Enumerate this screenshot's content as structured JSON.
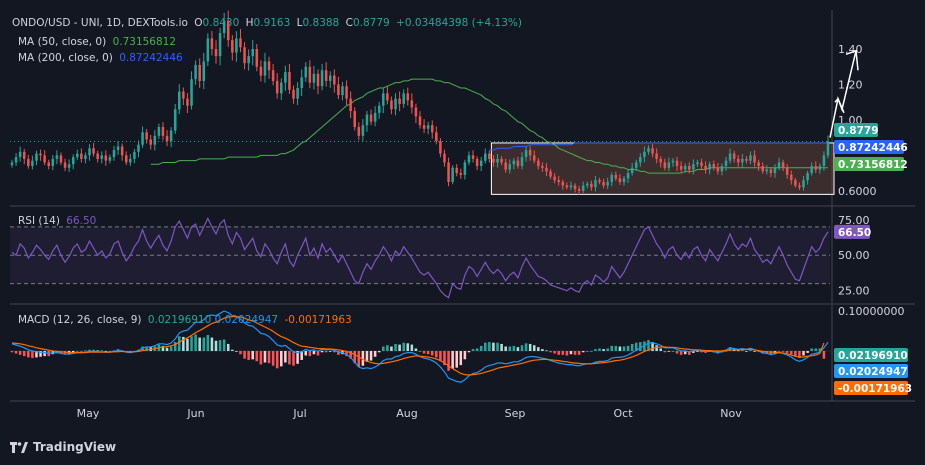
{
  "header": {
    "symbol": "ONDO/USD - UNI, 1D, DEXTools.io",
    "o_label": "O",
    "o": "0.8430",
    "h_label": "H",
    "h": "0.9163",
    "l_label": "L",
    "l": "0.8388",
    "c_label": "C",
    "c": "0.8779",
    "change": "+0.03484398 (+4.13%)",
    "ma50_label": "MA (50, close, 0)",
    "ma50": "0.73156812",
    "ma200_label": "MA (200, close, 0)",
    "ma200": "0.87242446"
  },
  "rsi_legend": {
    "label": "RSI (14)",
    "value": "66.50"
  },
  "macd_legend": {
    "label": "MACD (12, 26, close, 9)",
    "macd": "0.02196910",
    "signal": "0.02024947",
    "hist": "-0.00171963"
  },
  "brand": {
    "name": "TradingView"
  },
  "colors": {
    "background": "#131722",
    "up": "#26a69a",
    "down": "#ef5350",
    "ma50": "#4caf50",
    "ma200": "#2962ff",
    "rsi": "#7e57c2",
    "macd": "#2196f3",
    "signal": "#ff6d00",
    "box_border": "#ffffff",
    "box_fill": "#5d4037"
  },
  "chart_data": [
    {
      "type": "candlestick",
      "title": "ONDO/USD - UNI, 1D, DEXTools.io",
      "x_ticks": [
        "May",
        "Jun",
        "Jul",
        "Aug",
        "Sep",
        "Oct",
        "Nov"
      ],
      "y_ticks": [
        "1.40",
        "1.20",
        "1.00",
        "0.6000"
      ],
      "ylim": [
        0.52,
        1.62
      ],
      "price_labels": [
        {
          "text": "0.8779",
          "value": 0.8779,
          "color": "#26a69a"
        },
        {
          "text": "0.87242446",
          "value": 0.8724,
          "color": "#2962ff"
        },
        {
          "text": "0.73156812",
          "value": 0.7316,
          "color": "#4caf50"
        }
      ],
      "close_series": [
        0.76,
        0.79,
        0.82,
        0.78,
        0.74,
        0.77,
        0.81,
        0.8,
        0.76,
        0.74,
        0.78,
        0.8,
        0.76,
        0.73,
        0.75,
        0.79,
        0.81,
        0.78,
        0.8,
        0.84,
        0.81,
        0.78,
        0.8,
        0.77,
        0.79,
        0.83,
        0.85,
        0.8,
        0.76,
        0.78,
        0.82,
        0.86,
        0.93,
        0.89,
        0.86,
        0.91,
        0.96,
        0.91,
        0.88,
        0.94,
        1.06,
        1.16,
        1.12,
        1.08,
        1.23,
        1.31,
        1.22,
        1.33,
        1.46,
        1.4,
        1.36,
        1.49,
        1.56,
        1.45,
        1.38,
        1.46,
        1.41,
        1.32,
        1.36,
        1.4,
        1.3,
        1.25,
        1.33,
        1.28,
        1.22,
        1.15,
        1.21,
        1.27,
        1.17,
        1.12,
        1.18,
        1.24,
        1.3,
        1.21,
        1.26,
        1.19,
        1.28,
        1.22,
        1.25,
        1.2,
        1.14,
        1.19,
        1.12,
        1.05,
        0.96,
        0.91,
        0.97,
        1.03,
        0.99,
        1.04,
        1.08,
        1.15,
        1.11,
        1.06,
        1.12,
        1.09,
        1.15,
        1.11,
        1.07,
        1.02,
        0.97,
        0.95,
        0.97,
        0.93,
        0.88,
        0.81,
        0.76,
        0.65,
        0.73,
        0.7,
        0.69,
        0.76,
        0.8,
        0.78,
        0.74,
        0.77,
        0.81,
        0.78,
        0.76,
        0.78,
        0.76,
        0.72,
        0.75,
        0.77,
        0.74,
        0.79,
        0.83,
        0.8,
        0.77,
        0.74,
        0.73,
        0.71,
        0.68,
        0.66,
        0.65,
        0.63,
        0.62,
        0.63,
        0.61,
        0.6,
        0.63,
        0.64,
        0.62,
        0.66,
        0.65,
        0.63,
        0.65,
        0.69,
        0.67,
        0.65,
        0.67,
        0.7,
        0.73,
        0.76,
        0.79,
        0.82,
        0.84,
        0.81,
        0.78,
        0.76,
        0.73,
        0.76,
        0.77,
        0.74,
        0.72,
        0.74,
        0.72,
        0.75,
        0.76,
        0.74,
        0.72,
        0.75,
        0.73,
        0.71,
        0.74,
        0.77,
        0.81,
        0.78,
        0.76,
        0.78,
        0.77,
        0.8,
        0.76,
        0.74,
        0.71,
        0.72,
        0.7,
        0.73,
        0.76,
        0.73,
        0.69,
        0.66,
        0.63,
        0.62,
        0.66,
        0.7,
        0.74,
        0.72,
        0.74,
        0.8,
        0.88
      ],
      "ma50": [
        0.75,
        0.75,
        0.75,
        0.76,
        0.76,
        0.76,
        0.76,
        0.77,
        0.77,
        0.77,
        0.77,
        0.77,
        0.78,
        0.78,
        0.78,
        0.78,
        0.78,
        0.78,
        0.78,
        0.79,
        0.79,
        0.79,
        0.79,
        0.79,
        0.79,
        0.79,
        0.79,
        0.8,
        0.8,
        0.8,
        0.8,
        0.8,
        0.81,
        0.81,
        0.82,
        0.83,
        0.85,
        0.87,
        0.88,
        0.9,
        0.92,
        0.94,
        0.96,
        0.98,
        1.0,
        1.02,
        1.04,
        1.06,
        1.08,
        1.09,
        1.11,
        1.12,
        1.13,
        1.15,
        1.16,
        1.17,
        1.18,
        1.18,
        1.19,
        1.2,
        1.21,
        1.21,
        1.22,
        1.22,
        1.23,
        1.23,
        1.23,
        1.23,
        1.23,
        1.23,
        1.22,
        1.22,
        1.21,
        1.21,
        1.2,
        1.19,
        1.18,
        1.18,
        1.17,
        1.16,
        1.15,
        1.14,
        1.12,
        1.11,
        1.09,
        1.08,
        1.06,
        1.05,
        1.03,
        1.01,
        0.99,
        0.98,
        0.96,
        0.94,
        0.93,
        0.91,
        0.9,
        0.88,
        0.87,
        0.86,
        0.84,
        0.83,
        0.82,
        0.81,
        0.8,
        0.79,
        0.78,
        0.77,
        0.77,
        0.76,
        0.76,
        0.75,
        0.75,
        0.74,
        0.74,
        0.73,
        0.73,
        0.72,
        0.72,
        0.72,
        0.71,
        0.71,
        0.7,
        0.7,
        0.7,
        0.7,
        0.7,
        0.7,
        0.7,
        0.7,
        0.7,
        0.71,
        0.71,
        0.71,
        0.72,
        0.72,
        0.72,
        0.73,
        0.73,
        0.73,
        0.73,
        0.73,
        0.73,
        0.73,
        0.73,
        0.73,
        0.73,
        0.73,
        0.73,
        0.73,
        0.73,
        0.73,
        0.73,
        0.73,
        0.73,
        0.73,
        0.73,
        0.73,
        0.73,
        0.73,
        0.73,
        0.73,
        0.73,
        0.73,
        0.73,
        0.73,
        0.73
      ],
      "ma200": [
        0.83,
        0.83,
        0.84,
        0.84,
        0.84,
        0.84,
        0.85,
        0.85,
        0.85,
        0.85,
        0.86,
        0.86,
        0.86,
        0.86,
        0.86,
        0.86,
        0.86,
        0.86,
        0.86,
        0.86,
        0.86,
        0.87,
        0.87,
        0.87,
        0.87,
        0.87,
        0.87,
        0.87,
        0.87,
        0.87,
        0.87,
        0.87,
        0.87,
        0.87,
        0.87,
        0.87,
        0.87,
        0.87,
        0.87,
        0.87,
        0.87,
        0.87,
        0.87,
        0.87,
        0.87,
        0.87,
        0.87,
        0.87,
        0.87,
        0.87,
        0.87,
        0.87,
        0.87,
        0.87,
        0.87,
        0.87,
        0.87,
        0.87,
        0.87,
        0.87,
        0.87,
        0.87,
        0.87,
        0.87,
        0.87,
        0.87,
        0.87,
        0.87,
        0.87,
        0.87,
        0.87,
        0.87,
        0.87,
        0.87,
        0.87,
        0.87,
        0.87,
        0.87,
        0.87,
        0.87,
        0.87,
        0.87,
        0.87,
        0.87
      ],
      "annotations": [
        "consolidation box",
        "arrows up"
      ]
    },
    {
      "type": "line",
      "title": "RSI (14)",
      "y_ticks": [
        "75.00",
        "50.00",
        "25.00"
      ],
      "ylim": [
        17,
        84
      ],
      "levels": [
        70,
        50,
        30
      ],
      "last_value": 66.5,
      "values": [
        52,
        50,
        58,
        55,
        48,
        52,
        57,
        54,
        50,
        47,
        53,
        57,
        50,
        45,
        49,
        55,
        58,
        52,
        54,
        60,
        55,
        50,
        53,
        48,
        51,
        58,
        60,
        52,
        46,
        50,
        56,
        60,
        68,
        60,
        55,
        60,
        64,
        57,
        53,
        60,
        70,
        74,
        68,
        62,
        70,
        72,
        64,
        70,
        76,
        70,
        65,
        72,
        75,
        64,
        58,
        66,
        62,
        54,
        58,
        62,
        53,
        49,
        58,
        54,
        48,
        44,
        52,
        58,
        46,
        42,
        50,
        56,
        62,
        50,
        55,
        48,
        58,
        52,
        55,
        50,
        45,
        50,
        44,
        38,
        32,
        30,
        38,
        44,
        40,
        46,
        50,
        56,
        52,
        46,
        53,
        50,
        56,
        52,
        48,
        43,
        38,
        36,
        38,
        34,
        30,
        25,
        22,
        20,
        30,
        27,
        26,
        36,
        42,
        40,
        35,
        40,
        45,
        40,
        37,
        40,
        37,
        32,
        36,
        38,
        34,
        42,
        48,
        43,
        39,
        35,
        34,
        32,
        29,
        28,
        27,
        26,
        25,
        27,
        25,
        24,
        30,
        32,
        29,
        36,
        34,
        31,
        34,
        42,
        38,
        34,
        38,
        44,
        50,
        56,
        62,
        68,
        70,
        64,
        58,
        54,
        48,
        54,
        56,
        50,
        47,
        52,
        48,
        54,
        56,
        50,
        46,
        54,
        50,
        46,
        52,
        58,
        65,
        58,
        54,
        58,
        56,
        62,
        54,
        50,
        45,
        47,
        44,
        50,
        56,
        50,
        43,
        38,
        33,
        32,
        40,
        48,
        56,
        52,
        55,
        62,
        66.5
      ]
    },
    {
      "type": "bar",
      "title": "MACD (12, 26, close, 9)",
      "y_ticks": [
        "0.10000000"
      ],
      "ylim": [
        -0.125,
        0.115
      ],
      "labels": [
        {
          "text": "0.02196910",
          "value": 0.022,
          "color": "#26a69a"
        },
        {
          "text": "0.02024947",
          "value": 0.0202,
          "color": "#2196f3"
        },
        {
          "text": "-0.00171963",
          "value": -0.0017,
          "color": "#ff6d00"
        }
      ],
      "macd": [
        0.018,
        0.015,
        0.012,
        0.008,
        0.003,
        0.0,
        -0.002,
        -0.003,
        -0.004,
        -0.006,
        -0.005,
        -0.004,
        -0.006,
        -0.008,
        -0.008,
        -0.006,
        -0.004,
        -0.004,
        -0.003,
        -0.001,
        -0.001,
        -0.002,
        -0.002,
        -0.003,
        -0.003,
        -0.001,
        0.001,
        0.0,
        -0.003,
        -0.004,
        -0.002,
        0.001,
        0.008,
        0.01,
        0.01,
        0.013,
        0.018,
        0.018,
        0.016,
        0.02,
        0.03,
        0.045,
        0.05,
        0.052,
        0.062,
        0.072,
        0.072,
        0.078,
        0.088,
        0.09,
        0.088,
        0.094,
        0.1,
        0.096,
        0.088,
        0.086,
        0.08,
        0.07,
        0.064,
        0.062,
        0.054,
        0.044,
        0.042,
        0.036,
        0.026,
        0.015,
        0.012,
        0.014,
        0.006,
        -0.002,
        -0.004,
        -0.002,
        0.004,
        0.001,
        0.003,
        -0.001,
        0.004,
        0.003,
        0.004,
        0.002,
        -0.003,
        -0.004,
        -0.009,
        -0.016,
        -0.028,
        -0.04,
        -0.044,
        -0.042,
        -0.044,
        -0.04,
        -0.034,
        -0.024,
        -0.02,
        -0.02,
        -0.014,
        -0.012,
        -0.006,
        -0.004,
        -0.004,
        -0.008,
        -0.014,
        -0.018,
        -0.02,
        -0.024,
        -0.03,
        -0.04,
        -0.052,
        -0.068,
        -0.072,
        -0.076,
        -0.078,
        -0.072,
        -0.062,
        -0.056,
        -0.054,
        -0.048,
        -0.04,
        -0.036,
        -0.034,
        -0.03,
        -0.03,
        -0.032,
        -0.03,
        -0.027,
        -0.027,
        -0.022,
        -0.016,
        -0.014,
        -0.014,
        -0.016,
        -0.018,
        -0.02,
        -0.024,
        -0.027,
        -0.03,
        -0.032,
        -0.034,
        -0.034,
        -0.036,
        -0.037,
        -0.034,
        -0.032,
        -0.032,
        -0.028,
        -0.026,
        -0.026,
        -0.024,
        -0.018,
        -0.016,
        -0.016,
        -0.014,
        -0.01,
        -0.004,
        0.002,
        0.008,
        0.014,
        0.02,
        0.02,
        0.018,
        0.014,
        0.008,
        0.008,
        0.008,
        0.004,
        0.0,
        0.0,
        -0.002,
        0.0,
        0.002,
        0.0,
        -0.002,
        0.0,
        -0.002,
        -0.004,
        -0.002,
        0.002,
        0.008,
        0.006,
        0.004,
        0.006,
        0.004,
        0.007,
        0.003,
        0.0,
        -0.005,
        -0.006,
        -0.009,
        -0.007,
        -0.004,
        -0.006,
        -0.01,
        -0.015,
        -0.022,
        -0.026,
        -0.022,
        -0.016,
        -0.008,
        -0.006,
        -0.002,
        0.008,
        0.022
      ],
      "signal": [
        0.02,
        0.019,
        0.018,
        0.016,
        0.013,
        0.011,
        0.008,
        0.006,
        0.004,
        0.002,
        0.0,
        -0.001,
        -0.002,
        -0.003,
        -0.004,
        -0.004,
        -0.004,
        -0.004,
        -0.004,
        -0.003,
        -0.003,
        -0.003,
        -0.003,
        -0.003,
        -0.003,
        -0.002,
        -0.002,
        -0.001,
        -0.002,
        -0.002,
        -0.002,
        -0.001,
        0.001,
        0.003,
        0.004,
        0.006,
        0.008,
        0.01,
        0.011,
        0.013,
        0.016,
        0.022,
        0.028,
        0.033,
        0.039,
        0.046,
        0.051,
        0.057,
        0.063,
        0.069,
        0.072,
        0.077,
        0.082,
        0.085,
        0.086,
        0.086,
        0.085,
        0.082,
        0.078,
        0.075,
        0.07,
        0.065,
        0.06,
        0.055,
        0.049,
        0.042,
        0.036,
        0.032,
        0.027,
        0.021,
        0.016,
        0.012,
        0.011,
        0.009,
        0.008,
        0.006,
        0.006,
        0.005,
        0.005,
        0.004,
        0.003,
        0.001,
        -0.001,
        -0.004,
        -0.009,
        -0.015,
        -0.021,
        -0.025,
        -0.029,
        -0.031,
        -0.032,
        -0.031,
        -0.029,
        -0.027,
        -0.025,
        -0.022,
        -0.019,
        -0.016,
        -0.014,
        -0.012,
        -0.013,
        -0.014,
        -0.015,
        -0.017,
        -0.02,
        -0.024,
        -0.03,
        -0.037,
        -0.044,
        -0.05,
        -0.056,
        -0.059,
        -0.06,
        -0.059,
        -0.058,
        -0.056,
        -0.053,
        -0.05,
        -0.047,
        -0.043,
        -0.041,
        -0.039,
        -0.037,
        -0.035,
        -0.033,
        -0.031,
        -0.028,
        -0.025,
        -0.023,
        -0.022,
        -0.021,
        -0.021,
        -0.022,
        -0.023,
        -0.024,
        -0.026,
        -0.027,
        -0.029,
        -0.03,
        -0.031,
        -0.032,
        -0.032,
        -0.032,
        -0.031,
        -0.03,
        -0.029,
        -0.028,
        -0.026,
        -0.024,
        -0.023,
        -0.021,
        -0.018,
        -0.015,
        -0.011,
        -0.006,
        -0.001,
        0.003,
        0.006,
        0.009,
        0.01,
        0.01,
        0.009,
        0.009,
        0.008,
        0.006,
        0.005,
        0.004,
        0.003,
        0.003,
        0.002,
        0.001,
        0.001,
        0.0,
        0.0,
        0.0,
        0.002,
        0.002,
        0.003,
        0.003,
        0.003,
        0.004,
        0.004,
        0.003,
        0.001,
        -0.001,
        -0.002,
        -0.003,
        -0.003,
        -0.004,
        -0.005,
        -0.007,
        -0.01,
        -0.013,
        -0.015,
        -0.015,
        -0.013,
        -0.012,
        -0.01,
        -0.006,
        0.02
      ]
    }
  ]
}
